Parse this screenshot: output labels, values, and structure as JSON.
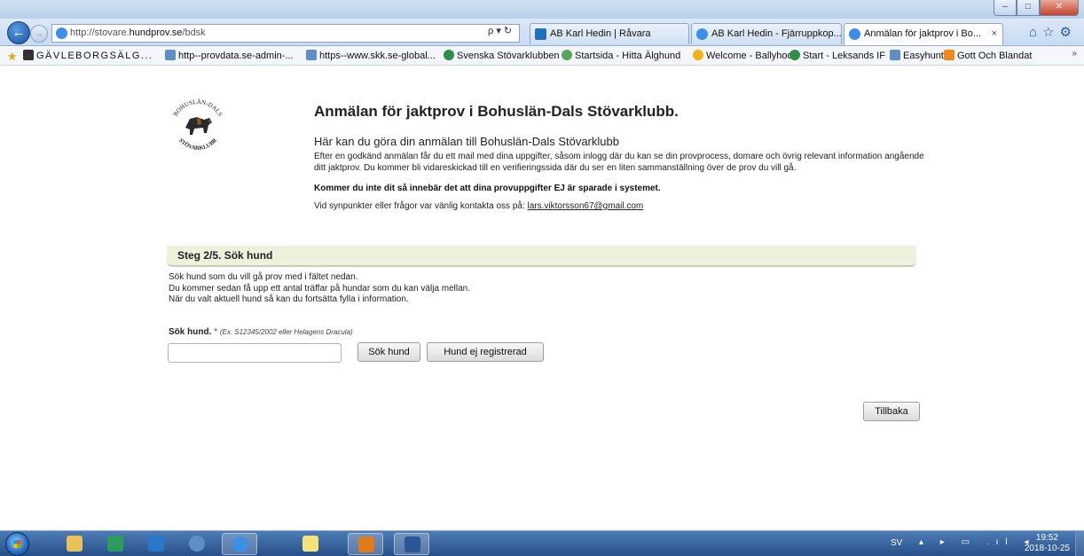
{
  "browser": {
    "address_prefix": "http://stovare.",
    "address_domain": "hundprov.se",
    "address_suffix": "/bdsk",
    "search_refresh": "ρ ▾ ↻",
    "tabs": [
      {
        "label": "AB Karl Hedin | Råvara"
      },
      {
        "label": "AB Karl Hedin - Fjärruppkop..."
      },
      {
        "label": "Anmälan för jaktprov i Bo...",
        "close": "×"
      }
    ],
    "nav_right_icons": "⌂☆⚙",
    "favorites": [
      "GÄVLEBORGSÄLG...",
      "http--provdata.se-admin-...",
      "https--www.skk.se-global...",
      "Svenska Stövarklubben",
      "Startsida - Hitta Älghund",
      "Welcome - Ballyhoo",
      "Start - Leksands IF",
      "Easyhunt",
      "Gott Och Blandat"
    ],
    "favorites_more": "»"
  },
  "page": {
    "logo_text_top": "BOHUSLÄN-DALS",
    "logo_text_bottom": "STÖVARKLUBB",
    "title": "Anmälan för jaktprov i Bohuslän-Dals Stövarklubb.",
    "intro_heading": "Här kan du göra din anmälan till Bohuslän-Dals Stövarklubb",
    "intro_text": "Efter en godkänd anmälan får du ett mail med dina uppgifter, såsom inlogg där du kan se din provprocess, domare och övrig relevant information angående ditt jaktprov. Du kommer bli vidareskickad till en verifieringssida där du ser en liten sammanställning över de prov du vill gå.",
    "warning": "Kommer du inte dit så innebär det att dina provuppgifter EJ är sparade i systemet.",
    "contact_prefix": "Vid synpunkter eller frågor var vänlig kontakta oss på: ",
    "contact_email": "lars.viktorsson67@gmail.com",
    "step_title": "Steg 2/5. Sök hund",
    "step_desc_1": "Sök hund som du vill gå prov med i fältet nedan.",
    "step_desc_2": "Du kommer sedan få upp ett antal träffar på hundar som du kan välja mellan.",
    "step_desc_3": "När du valt aktuell hund så kan du fortsätta fylla i information.",
    "field_label": "Sök hund.",
    "field_required": "*",
    "field_hint": "(Ex. S12345/2002 eller Helagens Dracula)",
    "search_value": "",
    "btn_search": "Sök hund",
    "btn_unregistered": "Hund ej registrerad",
    "btn_back": "Tillbaka"
  },
  "taskbar": {
    "lang": "SV",
    "tray_icons": "▴ ▸ ▭ .ıl ◂",
    "time": "19:52",
    "date": "2018-10-25"
  },
  "colors": {
    "step_bar_bg": "#ecf2dc",
    "required": "#c0261b",
    "taskbar": "#27508a"
  }
}
